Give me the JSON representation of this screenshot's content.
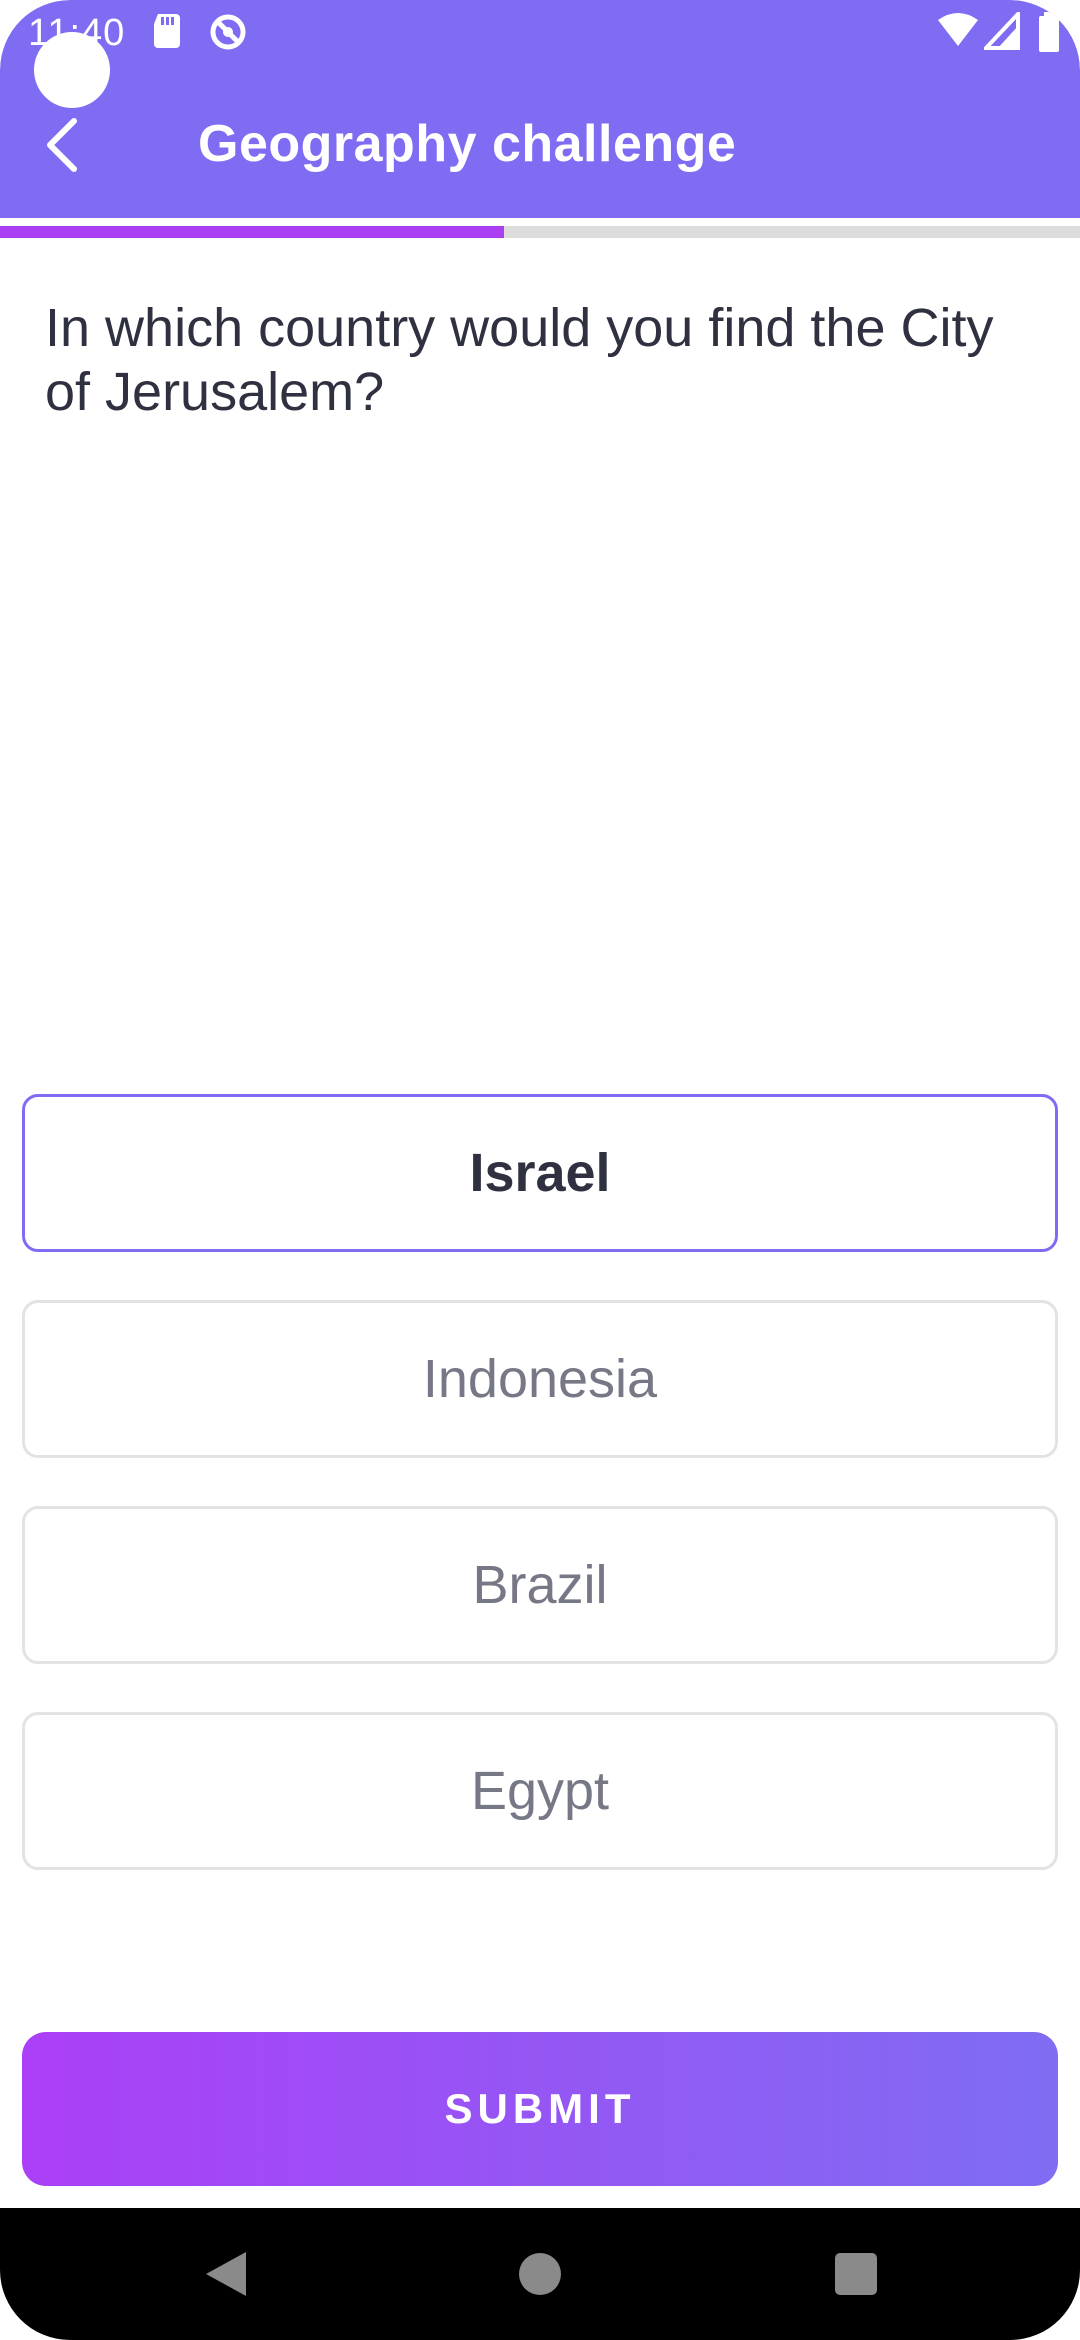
{
  "status_bar": {
    "time": "11:40",
    "icons": [
      "sd-card-icon",
      "location-off-icon",
      "wifi-icon",
      "signal-icon",
      "battery-icon"
    ]
  },
  "header": {
    "title": "Geography challenge",
    "back_icon": "back-arrow-icon"
  },
  "progress": {
    "fraction": 0.5
  },
  "quiz": {
    "question": "In which country would you find the City of Jerusalem?",
    "options": [
      {
        "label": "Israel",
        "selected": true
      },
      {
        "label": "Indonesia",
        "selected": false
      },
      {
        "label": "Brazil",
        "selected": false
      },
      {
        "label": "Egypt",
        "selected": false
      }
    ]
  },
  "submit": {
    "label": "SUBMIT"
  },
  "nav": {
    "icons": [
      "nav-back-icon",
      "nav-home-icon",
      "nav-recents-icon"
    ]
  },
  "colors": {
    "header": "#7e6df2",
    "progress_fill": "#a93ff0",
    "progress_track": "#dcdcdc",
    "selected_border": "#7e6df2",
    "submit_gradient_start": "#ab3ff7",
    "submit_gradient_end": "#7f6df2"
  }
}
